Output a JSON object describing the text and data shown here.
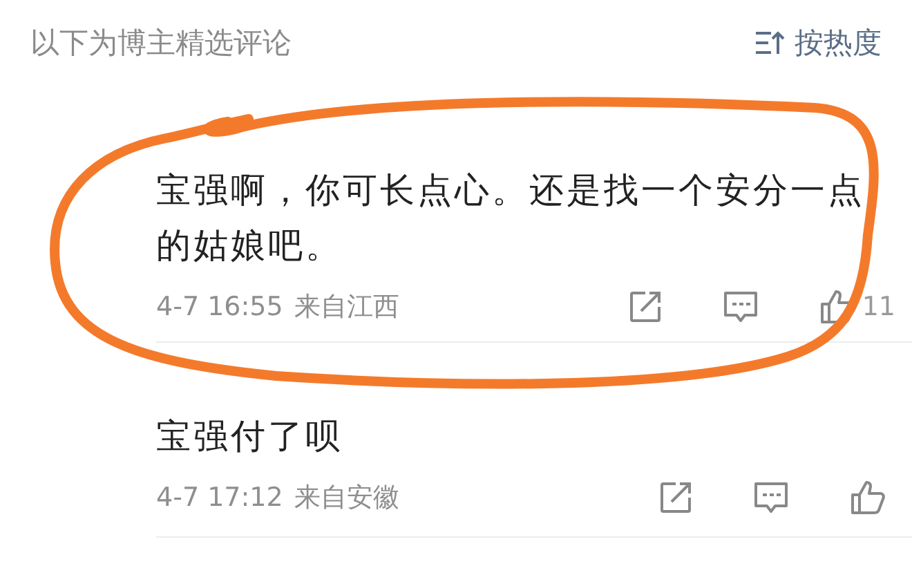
{
  "header": {
    "title": "以下为博主精选评论",
    "sort_label": "按热度"
  },
  "comments": [
    {
      "text": "宝强啊，你可长点心。还是找一个安分一点的姑娘吧。",
      "time": "4-7 16:55",
      "location": "来自江西",
      "likes": "11"
    },
    {
      "text": "宝强付了呗",
      "time": "4-7 17:12",
      "location": "来自安徽"
    }
  ]
}
